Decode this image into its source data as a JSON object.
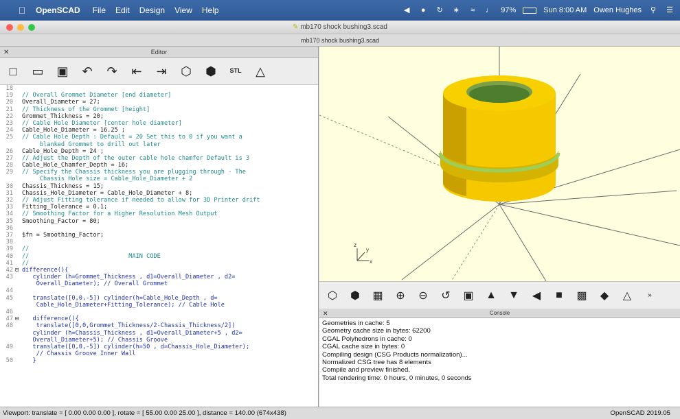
{
  "menubar": {
    "app": "OpenSCAD",
    "items": [
      "File",
      "Edit",
      "Design",
      "View",
      "Help"
    ],
    "battery": "97%",
    "clock": "Sun 8:00 AM",
    "user": "Owen Hughes"
  },
  "window": {
    "title": "mb170 shock bushing3.scad",
    "tab_title": "mb170 shock bushing3.scad"
  },
  "editor": {
    "title": "Editor",
    "lines": [
      {
        "n": "18",
        "f": "",
        "t": ""
      },
      {
        "n": "19",
        "f": "",
        "t": "// Overall Grommet Diameter [end diameter]",
        "cls": "c"
      },
      {
        "n": "20",
        "f": "",
        "t": "Overall_Diameter = 27;"
      },
      {
        "n": "21",
        "f": "",
        "t": "// Thickness of the Grommet [height]",
        "cls": "c"
      },
      {
        "n": "22",
        "f": "",
        "t": "Grommet_Thickness = 20;"
      },
      {
        "n": "23",
        "f": "",
        "t": "// Cable Hole Diameter [center hole diameter]",
        "cls": "c"
      },
      {
        "n": "24",
        "f": "",
        "t": "Cable_Hole_Diameter = 16.25 ;"
      },
      {
        "n": "25",
        "f": "",
        "t": "// Cable Hole Depth : Default = 20 Set this to 0 if you want a",
        "cls": "c"
      },
      {
        "n": "",
        "f": "",
        "t": "     blanked Grommet to drill out later",
        "cls": "c"
      },
      {
        "n": "26",
        "f": "",
        "t": "Cable_Hole_Depth = 24 ;"
      },
      {
        "n": "27",
        "f": "",
        "t": "// Adjust the Depth of the outer cable hole chamfer Default is 3",
        "cls": "c"
      },
      {
        "n": "28",
        "f": "",
        "t": "Cable_Hole_Chamfer_Depth = 16;"
      },
      {
        "n": "29",
        "f": "",
        "t": "// Specify the Chassis thickness you are plugging through - The",
        "cls": "c"
      },
      {
        "n": "",
        "f": "",
        "t": "     Chassis Hole size = Cable_Hole_Diameter + 2",
        "cls": "c"
      },
      {
        "n": "30",
        "f": "",
        "t": "Chassis_Thickness = 15;"
      },
      {
        "n": "31",
        "f": "",
        "t": "Chassis_Hole_Diameter = Cable_Hole_Diameter + 8;"
      },
      {
        "n": "32",
        "f": "",
        "t": "// Adjust Fitting tolerance if needed to allow for 3D Printer drift",
        "cls": "c"
      },
      {
        "n": "33",
        "f": "",
        "t": "Fitting_Tolerance = 0.1;"
      },
      {
        "n": "34",
        "f": "",
        "t": "// Smoothing Factor for a Higher Resolution Mesh Output",
        "cls": "c"
      },
      {
        "n": "35",
        "f": "",
        "t": "Smoothing_Factor = 80;"
      },
      {
        "n": "36",
        "f": "",
        "t": ""
      },
      {
        "n": "37",
        "f": "",
        "t": "$fn = Smoothing_Factor;"
      },
      {
        "n": "38",
        "f": "",
        "t": ""
      },
      {
        "n": "39",
        "f": "",
        "t": "//",
        "cls": "c"
      },
      {
        "n": "40",
        "f": "",
        "t": "//                            MAIN CODE",
        "cls": "c"
      },
      {
        "n": "41",
        "f": "",
        "t": "//",
        "cls": "c"
      },
      {
        "n": "42",
        "f": "⊟",
        "t": "difference(){",
        "cls": "k"
      },
      {
        "n": "43",
        "f": "",
        "t": "   cylinder (h=Grommet_Thickness , d1=Overall_Diameter , d2=",
        "cls": "k"
      },
      {
        "n": "",
        "f": "",
        "t": "    Overall_Diameter); // Overall Grommet",
        "cls": "k"
      },
      {
        "n": "44",
        "f": "",
        "t": ""
      },
      {
        "n": "45",
        "f": "",
        "t": "   translate([0,0,-5]) cylinder(h=Cable_Hole_Depth , d=",
        "cls": "k"
      },
      {
        "n": "",
        "f": "",
        "t": "    Cable_Hole_Diameter+Fitting_Tolerance); // Cable Hole",
        "cls": "k"
      },
      {
        "n": "46",
        "f": "",
        "t": ""
      },
      {
        "n": "47",
        "f": "⊟",
        "t": "   difference(){",
        "cls": "k"
      },
      {
        "n": "48",
        "f": "",
        "t": "    translate([0,0,Grommet_Thickness/2-Chassis_Thickness/2])",
        "cls": "k"
      },
      {
        "n": "",
        "f": "",
        "t": "   cylinder (h=Chassis_Thickness , d1=Overall_Diameter+5 , d2=",
        "cls": "k"
      },
      {
        "n": "",
        "f": "",
        "t": "   Overall_Diameter+5); // Chassis Groove",
        "cls": "k"
      },
      {
        "n": "49",
        "f": "",
        "t": "   translate([0,0,-5]) cylinder(h=50 , d=Chassis_Hole_Diameter);",
        "cls": "k"
      },
      {
        "n": "",
        "f": "",
        "t": "    // Chassis Groove Inner Wall",
        "cls": "k"
      },
      {
        "n": "50",
        "f": "",
        "t": "   }",
        "cls": "k"
      }
    ]
  },
  "console": {
    "title": "Console",
    "lines": [
      "Geometries in cache: 5",
      "Geometry cache size in bytes: 62200",
      "CGAL Polyhedrons in cache: 0",
      "CGAL cache size in bytes: 0",
      "Compiling design (CSG Products normalization)...",
      "Normalized CSG tree has 8 elements",
      "Compile and preview finished.",
      "Total rendering time: 0 hours, 0 minutes, 0 seconds"
    ]
  },
  "status": {
    "viewport": "Viewport: translate = [ 0.00 0.00 0.00 ], rotate = [ 55.00 0.00 25.00 ], distance = 140.00 (674x438)",
    "version": "OpenSCAD 2019.05"
  },
  "toolbar": {
    "stl_label": "STL"
  },
  "axis": {
    "z": "z",
    "y": "y",
    "x": "x"
  },
  "colors": {
    "model_body": "#f5c800",
    "model_shade": "#c9a000",
    "groove": "#9ccf5a",
    "viewport_bg": "#ffffdf"
  }
}
